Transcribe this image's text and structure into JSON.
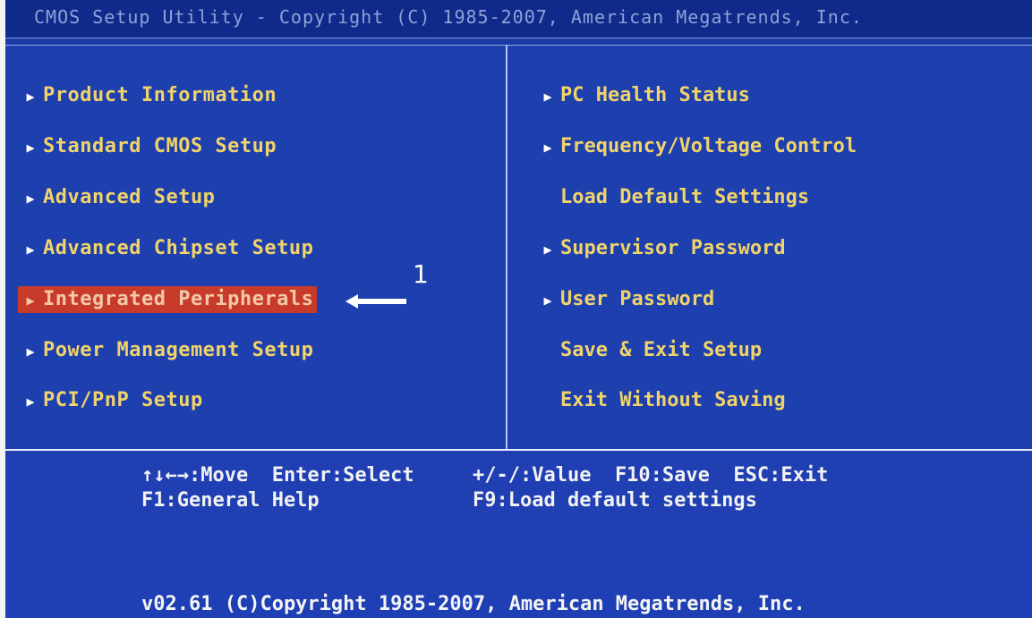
{
  "header": {
    "title": "CMOS Setup Utility - Copyright (C) 1985-2007, American Megatrends, Inc."
  },
  "left_menu": [
    {
      "label": "Product Information",
      "has_arrow": true
    },
    {
      "label": "Standard CMOS Setup",
      "has_arrow": true
    },
    {
      "label": "Advanced Setup",
      "has_arrow": true
    },
    {
      "label": "Advanced Chipset Setup",
      "has_arrow": true
    },
    {
      "label": "Integrated Peripherals",
      "has_arrow": true,
      "selected": true
    },
    {
      "label": "Power Management Setup",
      "has_arrow": true
    },
    {
      "label": "PCI/PnP Setup",
      "has_arrow": true
    }
  ],
  "right_menu": [
    {
      "label": "PC Health Status",
      "has_arrow": true
    },
    {
      "label": "Frequency/Voltage Control",
      "has_arrow": true
    },
    {
      "label": "Load Default Settings",
      "has_arrow": false
    },
    {
      "label": "Supervisor Password",
      "has_arrow": true
    },
    {
      "label": "User Password",
      "has_arrow": true
    },
    {
      "label": "Save & Exit Setup",
      "has_arrow": false
    },
    {
      "label": "Exit Without Saving",
      "has_arrow": false
    }
  ],
  "menu_arrow_glyph": "▶",
  "annotation": {
    "number": "1",
    "color": "#ffffff"
  },
  "help": {
    "line1_left": "↑↓←→:Move  Enter:Select",
    "line1_right": "+/-/:Value  F10:Save  ESC:Exit",
    "line2_left": "F1:General Help",
    "line2_right": "F9:Load default settings"
  },
  "footer": {
    "text": "v02.61 (C)Copyright 1985-2007, American Megatrends, Inc."
  },
  "colors": {
    "background": "#1b3aa6",
    "menu_text": "#f0d36a",
    "selected_bg": "#c83b2a",
    "help_text": "#f2f2f2"
  }
}
